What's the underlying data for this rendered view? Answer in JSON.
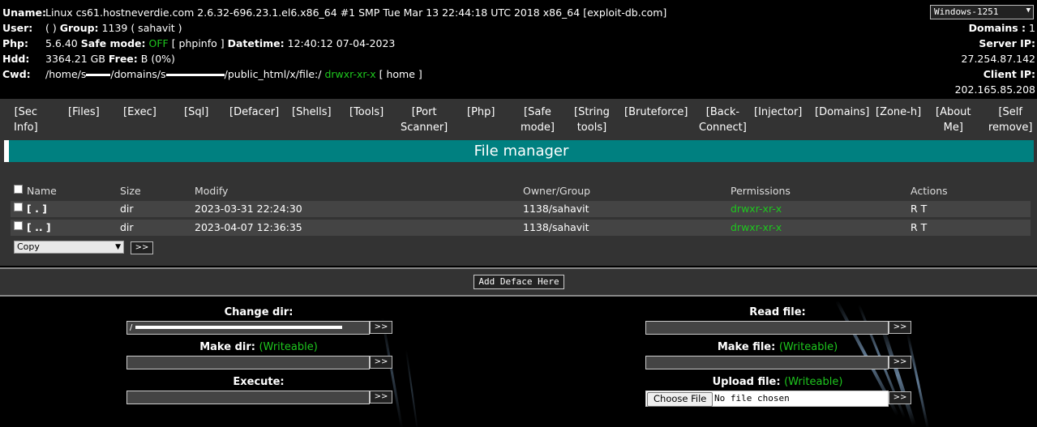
{
  "info": {
    "uname_label": "Uname:",
    "uname_value": "Linux cs61.hostneverdie.com 2.6.32-696.23.1.el6.x86_64 #1 SMP Tue Mar 13 22:44:18 UTC 2018 x86_64",
    "uname_link": "[exploit-db.com]",
    "user_label": "User:",
    "user_value": "( ) ",
    "group_label": "Group:",
    "group_value": "1139 ( sahavit )",
    "php_label": "Php:",
    "php_version": "5.6.40",
    "safe_mode_label": "Safe mode:",
    "safe_mode_value": "OFF",
    "phpinfo_link": "[ phpinfo ]",
    "datetime_label": "Datetime:",
    "datetime_value": "12:40:12 07-04-2023",
    "hdd_label": "Hdd:",
    "hdd_value": "3364.21 GB",
    "free_label": "Free:",
    "free_value": "B (0%)",
    "cwd_label": "Cwd:",
    "cwd_part1": "/home/s",
    "cwd_part2": "/domains/s",
    "cwd_part3": "/public_html/x/file:/",
    "cwd_perms": "drwxr-xr-x",
    "home_link": "[ home ]",
    "charset_selected": "Windows-1251",
    "domains_label": "Domains :",
    "domains_value": "1",
    "server_ip_label": "Server IP:",
    "server_ip_value": "27.254.87.142",
    "client_ip_label": "Client IP:",
    "client_ip_value": "202.165.85.208"
  },
  "nav": [
    {
      "line1": "[Sec",
      "line2": "Info]"
    },
    {
      "line1": "[Files]",
      "line2": ""
    },
    {
      "line1": "[Exec]",
      "line2": ""
    },
    {
      "line1": "[Sql]",
      "line2": ""
    },
    {
      "line1": "[Defacer]",
      "line2": ""
    },
    {
      "line1": "[Shells]",
      "line2": ""
    },
    {
      "line1": "[Tools]",
      "line2": ""
    },
    {
      "line1": "[Port",
      "line2": "Scanner]"
    },
    {
      "line1": "[Php]",
      "line2": ""
    },
    {
      "line1": "[Safe",
      "line2": "mode]"
    },
    {
      "line1": "[String",
      "line2": "tools]"
    },
    {
      "line1": "[Bruteforce]",
      "line2": ""
    },
    {
      "line1": "[Back-",
      "line2": "Connect]"
    },
    {
      "line1": "[Injector]",
      "line2": ""
    },
    {
      "line1": "[Domains]",
      "line2": ""
    },
    {
      "line1": "[Zone-h]",
      "line2": ""
    },
    {
      "line1": "[About",
      "line2": "Me]"
    },
    {
      "line1": "[Self",
      "line2": "remove]"
    }
  ],
  "file_manager": {
    "title": "File manager",
    "headers": {
      "name": "Name",
      "size": "Size",
      "modify": "Modify",
      "owner": "Owner/Group",
      "permissions": "Permissions",
      "actions": "Actions"
    },
    "rows": [
      {
        "name": "[ . ]",
        "size": "dir",
        "modify": "2023-03-31 22:24:30",
        "owner": "1138/sahavit",
        "perms": "drwxr-xr-x",
        "actions": "R T"
      },
      {
        "name": "[ .. ]",
        "size": "dir",
        "modify": "2023-04-07 12:36:35",
        "owner": "1138/sahavit",
        "perms": "drwxr-xr-x",
        "actions": "R T"
      }
    ],
    "action_select": "Copy",
    "go_label": ">>"
  },
  "deface_button": "Add Deface Here",
  "tools": {
    "change_dir_label": "Change dir:",
    "change_dir_value": "/",
    "make_dir_label": "Make dir:",
    "make_dir_note": "(Writeable)",
    "execute_label": "Execute:",
    "read_file_label": "Read file:",
    "make_file_label": "Make file:",
    "make_file_note": "(Writeable)",
    "upload_file_label": "Upload file:",
    "upload_file_note": "(Writeable)",
    "choose_file": "Choose File",
    "no_file": "No file chosen",
    "go_label": ">>"
  }
}
